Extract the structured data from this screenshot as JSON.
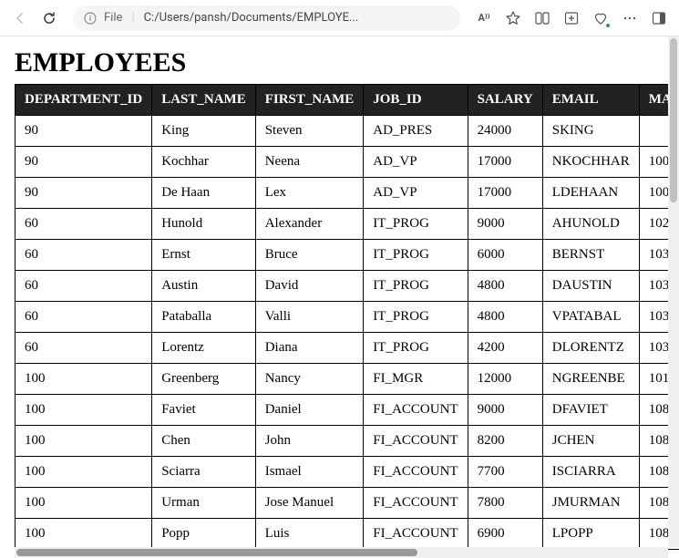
{
  "toolbar": {
    "address_label": "File",
    "address_path": "C:/Users/pansh/Documents/EMPLOYE...",
    "read_aloud": "A⁾⁾"
  },
  "page": {
    "title": "EMPLOYEES"
  },
  "table": {
    "headers": [
      "DEPARTMENT_ID",
      "LAST_NAME",
      "FIRST_NAME",
      "JOB_ID",
      "SALARY",
      "EMAIL",
      "MANA"
    ],
    "rows": [
      [
        "90",
        "King",
        "Steven",
        "AD_PRES",
        "24000",
        "SKING",
        ""
      ],
      [
        "90",
        "Kochhar",
        "Neena",
        "AD_VP",
        "17000",
        "NKOCHHAR",
        "100"
      ],
      [
        "90",
        "De Haan",
        "Lex",
        "AD_VP",
        "17000",
        "LDEHAAN",
        "100"
      ],
      [
        "60",
        "Hunold",
        "Alexander",
        "IT_PROG",
        "9000",
        "AHUNOLD",
        "102"
      ],
      [
        "60",
        "Ernst",
        "Bruce",
        "IT_PROG",
        "6000",
        "BERNST",
        "103"
      ],
      [
        "60",
        "Austin",
        "David",
        "IT_PROG",
        "4800",
        "DAUSTIN",
        "103"
      ],
      [
        "60",
        "Pataballa",
        "Valli",
        "IT_PROG",
        "4800",
        "VPATABAL",
        "103"
      ],
      [
        "60",
        "Lorentz",
        "Diana",
        "IT_PROG",
        "4200",
        "DLORENTZ",
        "103"
      ],
      [
        "100",
        "Greenberg",
        "Nancy",
        "FI_MGR",
        "12000",
        "NGREENBE",
        "101"
      ],
      [
        "100",
        "Faviet",
        "Daniel",
        "FI_ACCOUNT",
        "9000",
        "DFAVIET",
        "108"
      ],
      [
        "100",
        "Chen",
        "John",
        "FI_ACCOUNT",
        "8200",
        "JCHEN",
        "108"
      ],
      [
        "100",
        "Sciarra",
        "Ismael",
        "FI_ACCOUNT",
        "7700",
        "ISCIARRA",
        "108"
      ],
      [
        "100",
        "Urman",
        "Jose Manuel",
        "FI_ACCOUNT",
        "7800",
        "JMURMAN",
        "108"
      ],
      [
        "100",
        "Popp",
        "Luis",
        "FI_ACCOUNT",
        "6900",
        "LPOPP",
        "108"
      ]
    ]
  }
}
